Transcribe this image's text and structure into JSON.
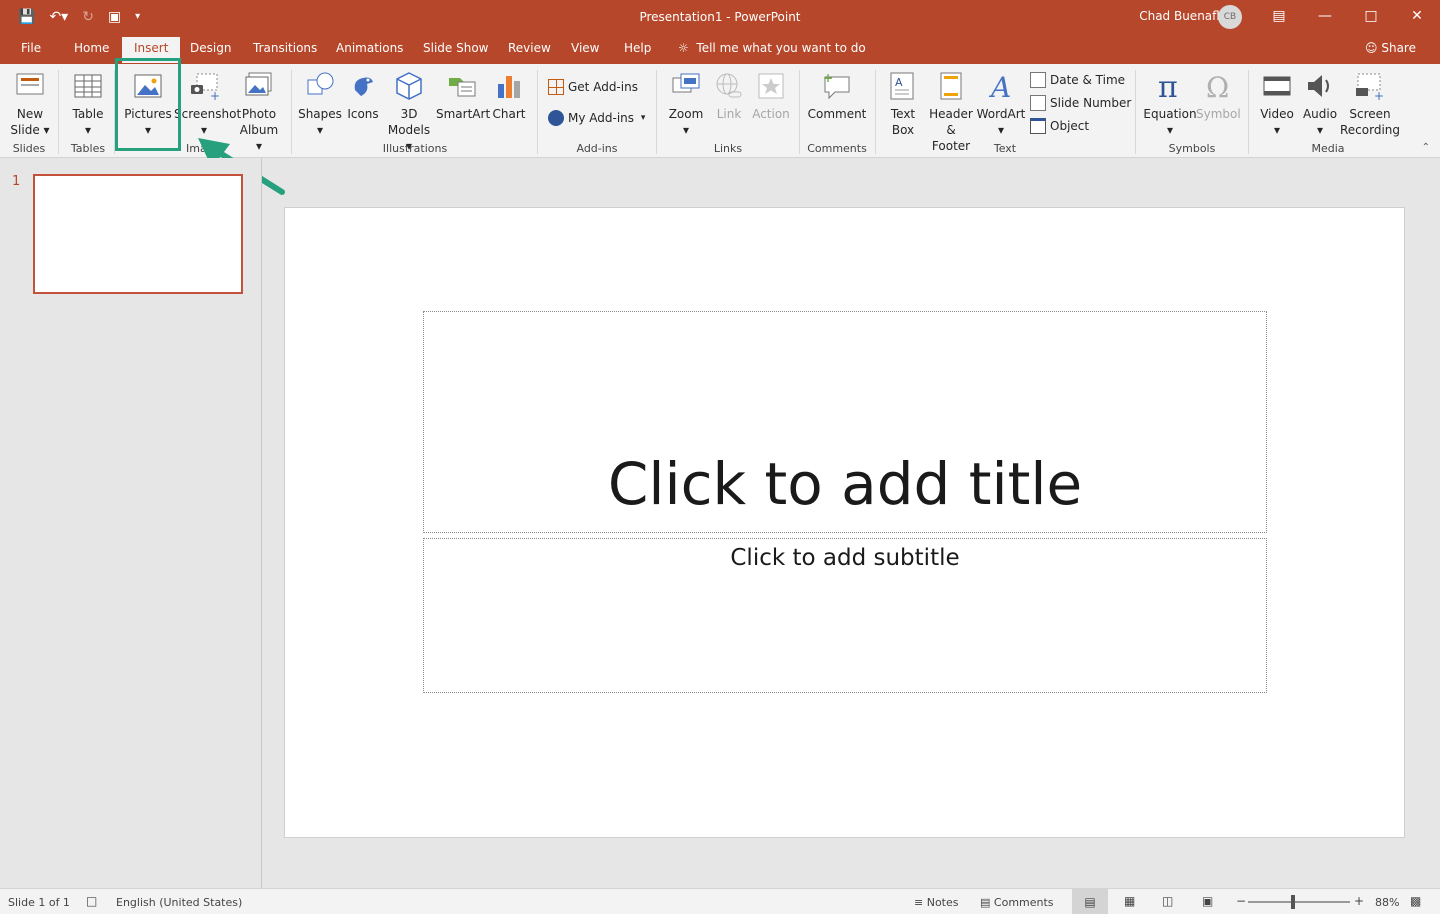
{
  "title_bar": {
    "doc_title": "Presentation1  -  PowerPoint",
    "user_name": "Chad Buenaflor",
    "user_initials": "CB"
  },
  "tabs": [
    {
      "label": "File"
    },
    {
      "label": "Home"
    },
    {
      "label": "Insert"
    },
    {
      "label": "Design"
    },
    {
      "label": "Transitions"
    },
    {
      "label": "Animations"
    },
    {
      "label": "Slide Show"
    },
    {
      "label": "Review"
    },
    {
      "label": "View"
    },
    {
      "label": "Help"
    }
  ],
  "active_tab": "Insert",
  "tell_me": "Tell me what you want to do",
  "share": "Share",
  "ribbon": {
    "new_slide": [
      "New",
      "Slide"
    ],
    "table": "Table",
    "pictures": "Pictures",
    "screenshot": "Screenshot",
    "photo_album": [
      "Photo",
      "Album"
    ],
    "shapes": "Shapes",
    "icons": "Icons",
    "models_3d": [
      "3D",
      "Models"
    ],
    "smartart": "SmartArt",
    "chart": "Chart",
    "get_addins": "Get Add-ins",
    "my_addins": "My Add-ins",
    "zoom": "Zoom",
    "link": "Link",
    "action": "Action",
    "comment": "Comment",
    "text_box": [
      "Text",
      "Box"
    ],
    "header_footer": [
      "Header",
      "& Footer"
    ],
    "wordart": "WordArt",
    "date_time": "Date & Time",
    "slide_number": "Slide Number",
    "object": "Object",
    "equation": "Equation",
    "symbol": "Symbol",
    "video": "Video",
    "audio": "Audio",
    "screen_recording": [
      "Screen",
      "Recording"
    ],
    "groups": {
      "slides": "Slides",
      "tables": "Tables",
      "images": "Ima",
      "illustrations": "Illustrations",
      "addins": "Add-ins",
      "links": "Links",
      "comments": "Comments",
      "text": "Text",
      "symbols": "Symbols",
      "media": "Media"
    }
  },
  "slide_panel": {
    "slide_number": "1"
  },
  "slide": {
    "title_placeholder": "Click to add title",
    "subtitle_placeholder": "Click to add subtitle"
  },
  "status_bar": {
    "slide_count": "Slide 1 of 1",
    "language": "English (United States)",
    "notes": "Notes",
    "comments": "Comments",
    "zoom": "88%"
  },
  "colors": {
    "accent": "#b7472a",
    "highlight": "#26a07d"
  }
}
